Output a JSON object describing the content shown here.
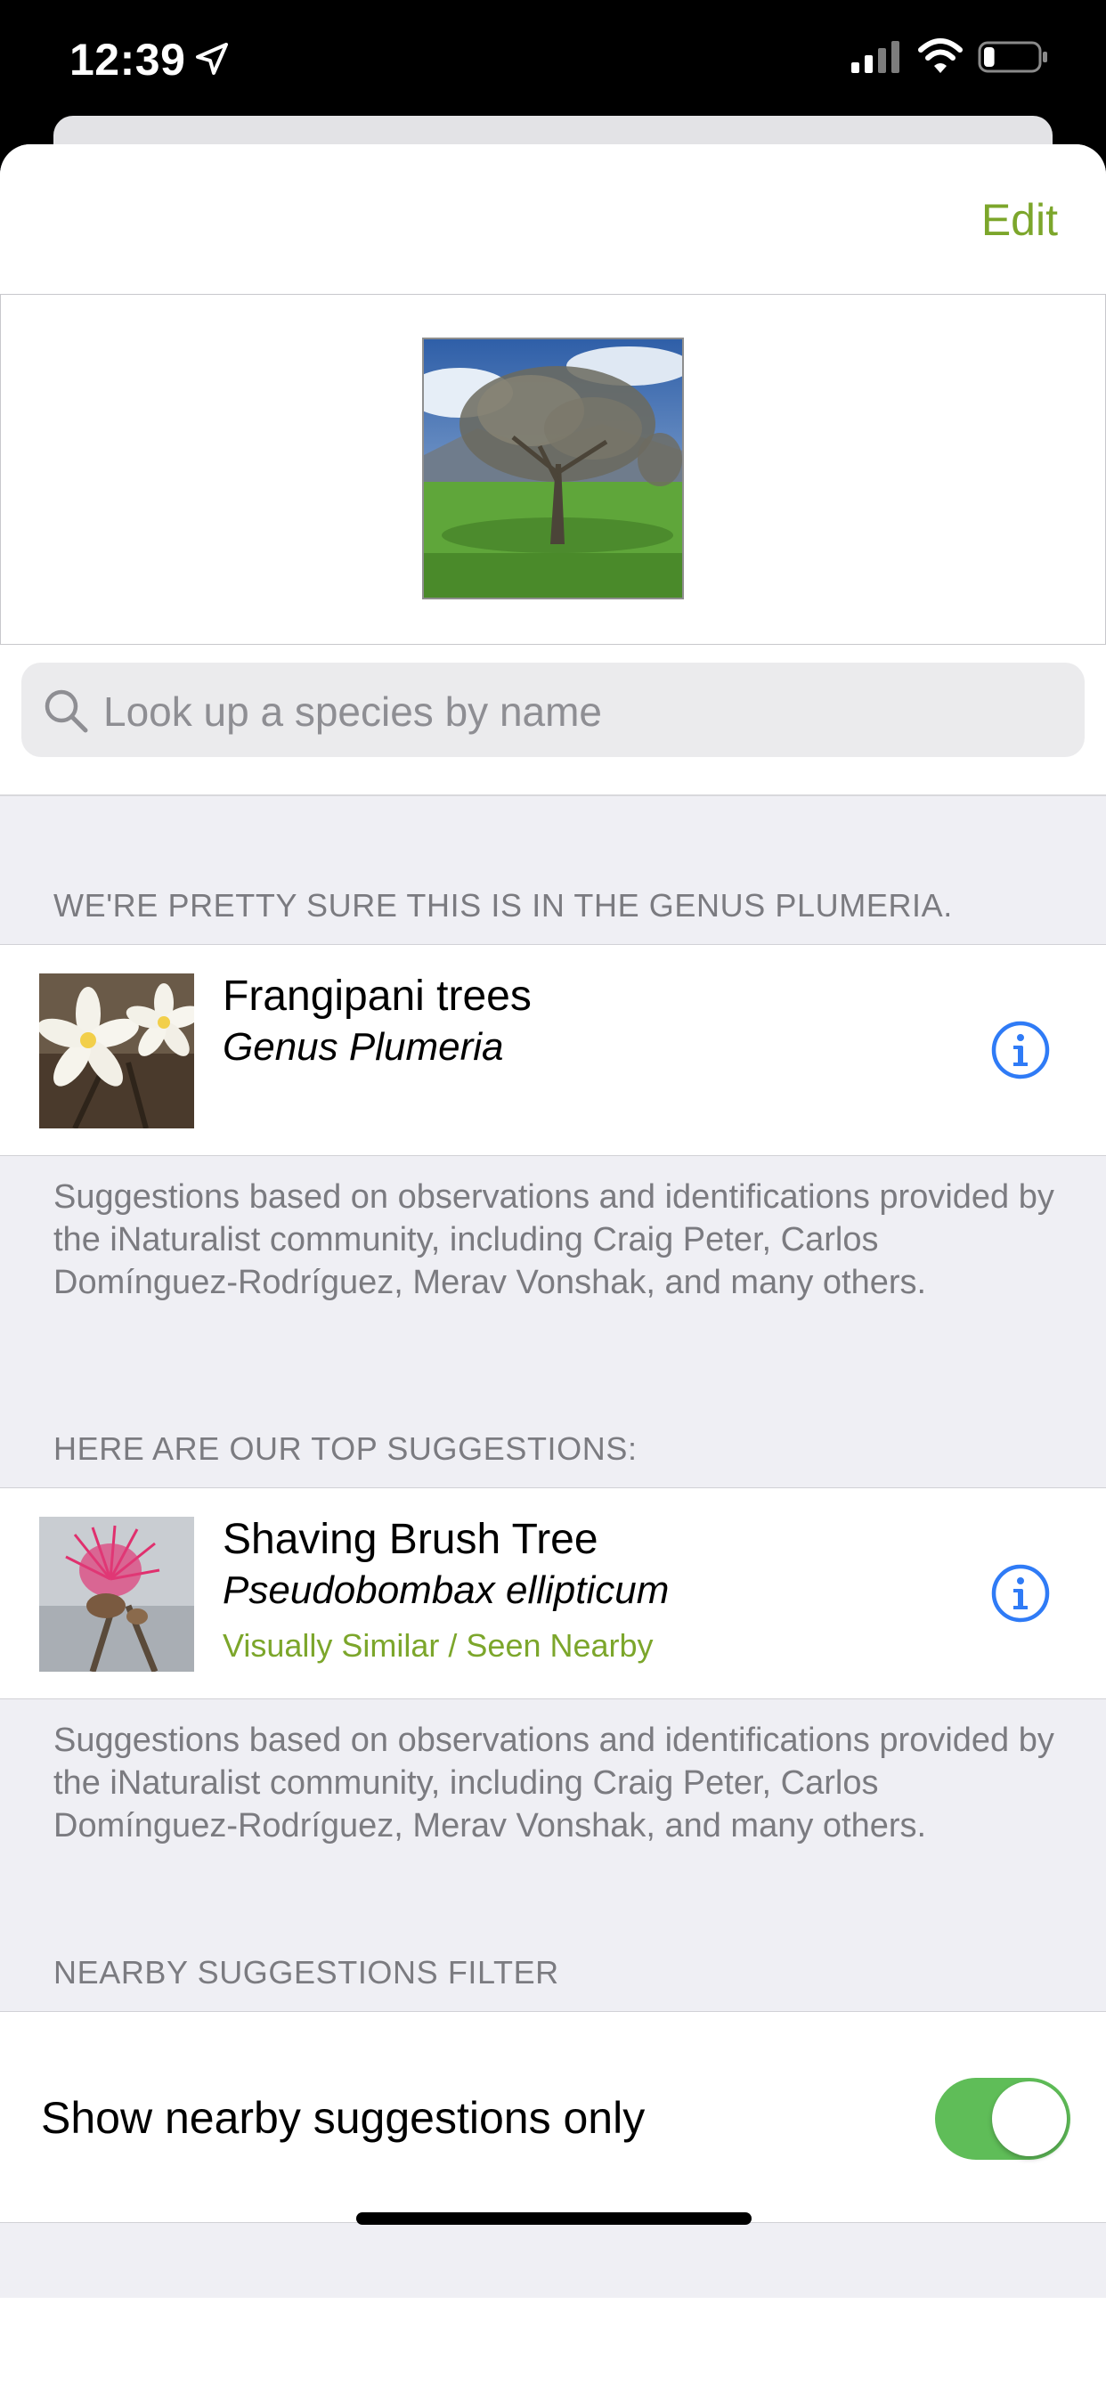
{
  "status_bar": {
    "time": "12:39",
    "location_icon": "location-arrow-icon",
    "signal_icon": "cellular-signal-icon",
    "wifi_icon": "wifi-icon",
    "battery_icon": "battery-icon",
    "battery_level": 0.2
  },
  "header": {
    "edit_label": "Edit"
  },
  "photo": {
    "icon": "observation-photo"
  },
  "search": {
    "placeholder": "Look up a species by name",
    "icon": "search-icon"
  },
  "genus_section": {
    "header": "WE'RE PRETTY SURE THIS IS IN THE GENUS PLUMERIA.",
    "item": {
      "common_name": "Frangipani trees",
      "scientific_name": "Genus Plumeria",
      "info_icon": "info-icon"
    },
    "footer": "Suggestions based on observations and identifications provided by the iNaturalist community, including Craig Peter, Carlos Domínguez-Rodríguez, Merav Vonshak, and many others."
  },
  "top_section": {
    "header": "HERE ARE OUR TOP SUGGESTIONS:",
    "item": {
      "common_name": "Shaving Brush Tree",
      "scientific_name": "Pseudobombax ellipticum",
      "tag": "Visually Similar / Seen Nearby",
      "info_icon": "info-icon"
    },
    "footer": "Suggestions based on observations and identifications provided by the iNaturalist community, including Craig Peter, Carlos Domínguez-Rodríguez, Merav Vonshak, and many others."
  },
  "filter_section": {
    "header": "NEARBY SUGGESTIONS FILTER",
    "toggle_label": "Show nearby suggestions only",
    "toggle_on": true
  },
  "colors": {
    "accent_green": "#7ca62b",
    "info_blue": "#2f7bf6",
    "toggle_green": "#5fbd58"
  }
}
